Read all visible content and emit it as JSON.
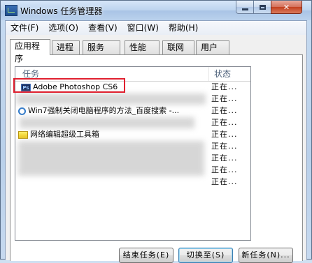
{
  "window": {
    "title": "Windows 任务管理器"
  },
  "menu": [
    "文件(F)",
    "选项(O)",
    "查看(V)",
    "窗口(W)",
    "帮助(H)"
  ],
  "tabs": [
    "应用程序",
    "进程",
    "服务",
    "性能",
    "联网",
    "用户"
  ],
  "active_tab": "应用程序",
  "table": {
    "headers": {
      "task": "任务",
      "status": "状态"
    },
    "rows": [
      {
        "task": "Adobe Photoshop CS6",
        "icon": "photoshop-icon",
        "status": "正在..."
      },
      {
        "task": "",
        "icon": "",
        "status": "正在..."
      },
      {
        "task": "Win7强制关闭电脑程序的方法_百度搜索 -...",
        "icon": "ie-icon",
        "status": "正在..."
      },
      {
        "task": "",
        "icon": "",
        "status": "正在..."
      },
      {
        "task": "网络编辑超级工具箱",
        "icon": "folder-icon",
        "status": "正在..."
      },
      {
        "task": "",
        "icon": "",
        "status": "正在..."
      },
      {
        "task": "",
        "icon": "",
        "status": "正在..."
      },
      {
        "task": "",
        "icon": "",
        "status": "正在..."
      },
      {
        "task": "",
        "icon": "",
        "status": "正在..."
      }
    ]
  },
  "buttons": {
    "end_task": "结束任务(E)",
    "switch_to": "切换至(S)",
    "new_task": "新任务(N)..."
  },
  "colors": {
    "highlight": "#e0202f",
    "titlebar": "#bcd3ee"
  }
}
